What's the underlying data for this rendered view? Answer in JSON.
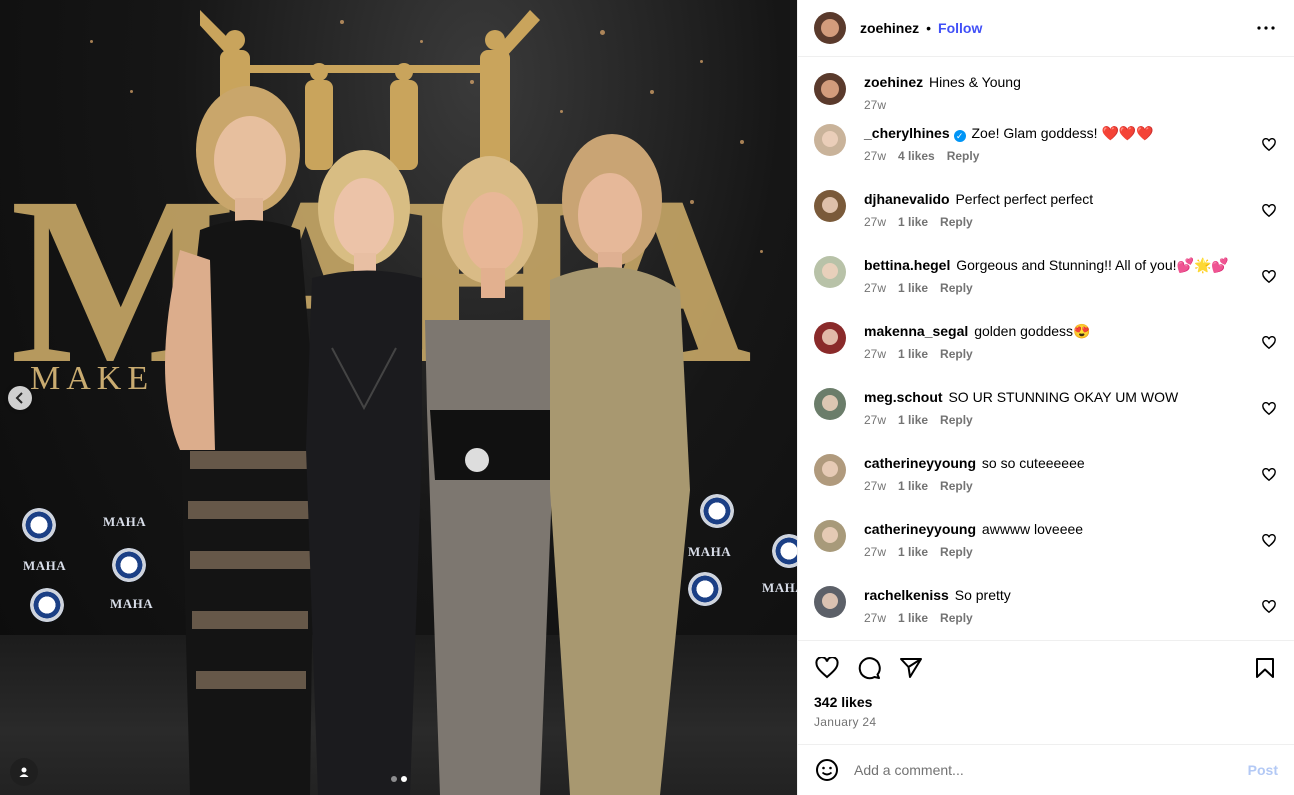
{
  "header": {
    "username": "zoehinez",
    "separator": "•",
    "follow_label": "Follow"
  },
  "caption": {
    "username": "zoehinez",
    "text": "Hines & Young",
    "time": "27w"
  },
  "photo": {
    "backdrop_title": "MAHA",
    "backdrop_subtitle": "MAKE A      N",
    "logo_text": "MAHA"
  },
  "comments": [
    {
      "username": "_cherylhines",
      "verified": true,
      "text": "Zoe! Glam goddess! ❤️❤️❤️",
      "time": "27w",
      "likes": "4 likes",
      "reply": "Reply",
      "avatar_color": "#c9b39a"
    },
    {
      "username": "djhanevalido",
      "verified": false,
      "text": "Perfect perfect perfect",
      "time": "27w",
      "likes": "1 like",
      "reply": "Reply",
      "avatar_color": "#7a5a3a"
    },
    {
      "username": "bettina.hegel",
      "verified": false,
      "text": "Gorgeous and Stunning!! All of you!💕🌟💕",
      "time": "27w",
      "likes": "1 like",
      "reply": "Reply",
      "avatar_color": "#b8c2a8"
    },
    {
      "username": "makenna_segal",
      "verified": false,
      "text": "golden goddess😍",
      "time": "27w",
      "likes": "1 like",
      "reply": "Reply",
      "avatar_color": "#8a2a2a"
    },
    {
      "username": "meg.schout",
      "verified": false,
      "text": "SO UR STUNNING OKAY UM WOW",
      "time": "27w",
      "likes": "1 like",
      "reply": "Reply",
      "avatar_color": "#6b7d6a"
    },
    {
      "username": "catherineyyoung",
      "verified": false,
      "text": "so so cuteeeeee",
      "time": "27w",
      "likes": "1 like",
      "reply": "Reply",
      "avatar_color": "#b09a7d"
    },
    {
      "username": "catherineyyoung",
      "verified": false,
      "text": "awwww loveeee",
      "time": "27w",
      "likes": "1 like",
      "reply": "Reply",
      "avatar_color": "#a89a7a"
    },
    {
      "username": "rachelkeniss",
      "verified": false,
      "text": "So pretty",
      "time": "27w",
      "likes": "1 like",
      "reply": "Reply",
      "avatar_color": "#5c6068"
    }
  ],
  "actions": {
    "likes_count": "342 likes",
    "date": "January 24"
  },
  "add_comment": {
    "placeholder": "Add a comment...",
    "post_label": "Post"
  },
  "colors": {
    "accent": "#4150f7",
    "muted": "#737373",
    "verified": "#0095f6"
  },
  "icons": {
    "like": "heart-icon",
    "comment": "comment-icon",
    "share": "paper-plane-icon",
    "save": "bookmark-icon",
    "more": "more-horizontal-icon",
    "emoji": "smiley-icon",
    "prev": "chevron-left-icon",
    "tag": "user-tag-icon"
  }
}
